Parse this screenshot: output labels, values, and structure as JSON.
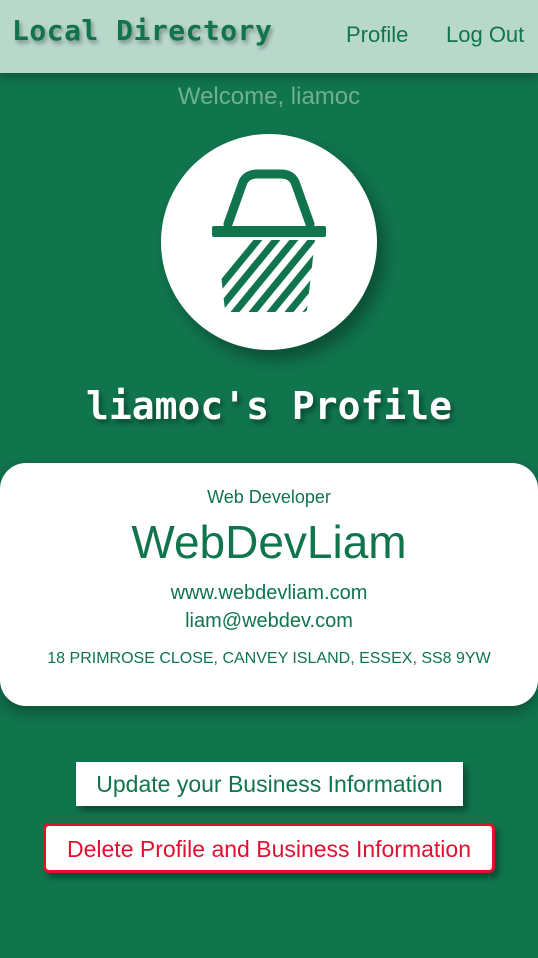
{
  "header": {
    "brand": "Local Directory",
    "nav": {
      "profile": "Profile",
      "logout": "Log Out"
    }
  },
  "welcome": "Welcome, liamoc",
  "avatar_icon": "basket-icon",
  "profile_title": "liamoc's Profile",
  "business": {
    "job_title": "Web Developer",
    "name": "WebDevLiam",
    "website": "www.webdevliam.com",
    "email": "liam@webdev.com",
    "address": "18 PRIMROSE CLOSE, CANVEY ISLAND, ESSEX, SS8 9YW"
  },
  "actions": {
    "update": "Update your Business Information",
    "delete": "Delete Profile and Business Information"
  },
  "colors": {
    "background": "#10744d",
    "topbar": "#b9d8cc",
    "danger": "#e0102e"
  }
}
